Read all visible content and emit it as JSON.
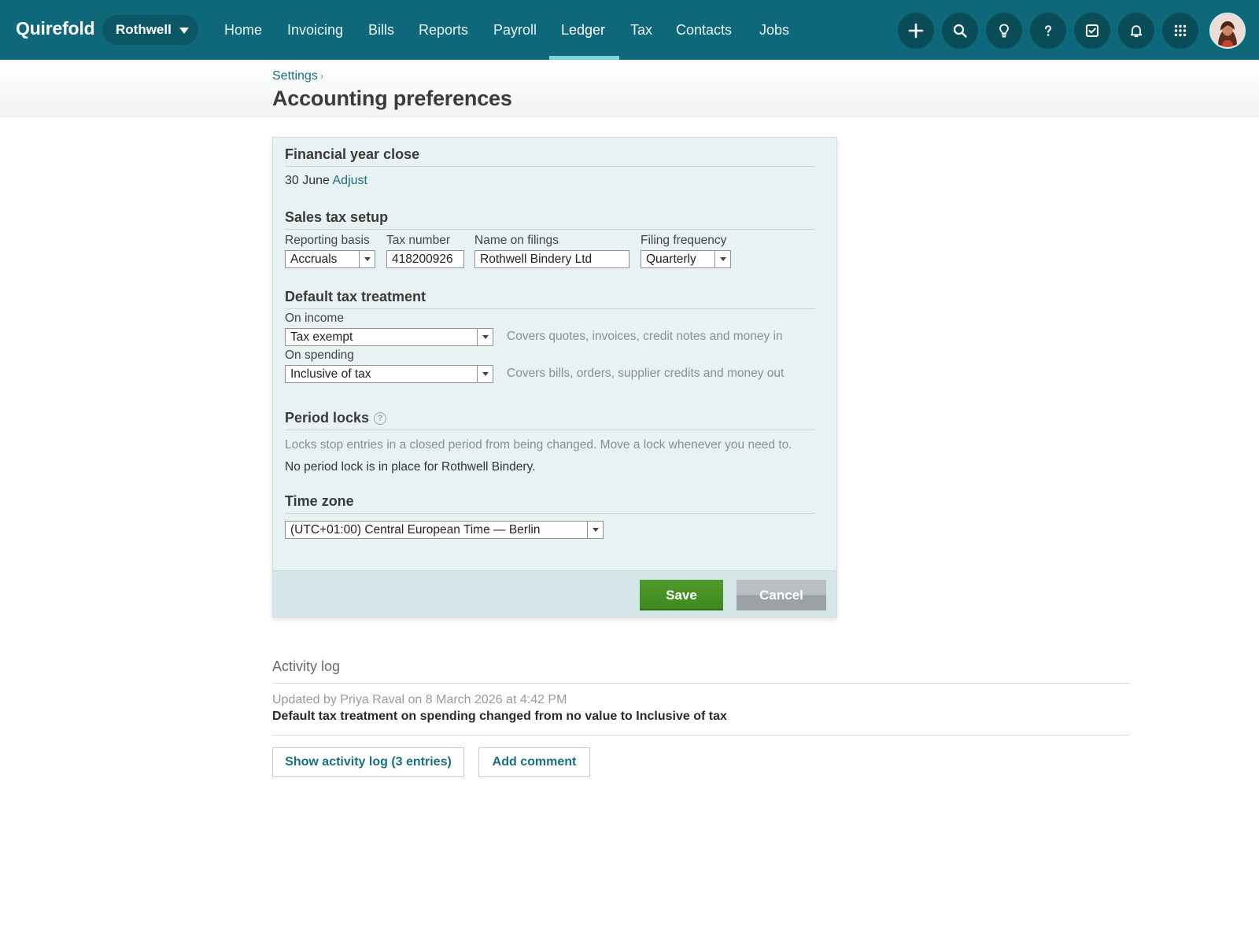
{
  "app": {
    "logo": "Quirefold",
    "org_switcher": "Rothwell"
  },
  "nav": {
    "items": [
      {
        "label": "Home"
      },
      {
        "label": "Invoicing"
      },
      {
        "label": "Bills"
      },
      {
        "label": "Reports"
      },
      {
        "label": "Payroll"
      },
      {
        "label": "Ledger",
        "active": true
      },
      {
        "label": "Tax"
      },
      {
        "label": "Contacts"
      },
      {
        "label": "Jobs"
      }
    ],
    "icons": [
      "plus-icon",
      "search-icon",
      "lightbulb-icon",
      "help-icon",
      "tasks-icon",
      "bell-icon",
      "apps-grid-icon"
    ]
  },
  "header": {
    "breadcrumb": "Settings",
    "breadcrumb_separator": "›",
    "title": "Accounting preferences"
  },
  "financial_year": {
    "title": "Financial year close",
    "value": "30 June",
    "adjust_label": "Adjust"
  },
  "sales_tax": {
    "title": "Sales tax setup",
    "reporting_basis_label": "Reporting basis",
    "reporting_basis_value": "Accruals",
    "tax_number_label": "Tax number",
    "tax_number_value": "418200926",
    "name_on_filings_label": "Name on filings",
    "name_on_filings_value": "Rothwell Bindery Ltd",
    "filing_frequency_label": "Filing frequency",
    "filing_frequency_value": "Quarterly"
  },
  "default_tax": {
    "title": "Default tax treatment",
    "income_label": "On income",
    "income_value": "Tax exempt",
    "income_hint": "Covers quotes, invoices, credit notes and money in",
    "spending_label": "On spending",
    "spending_value": "Inclusive of tax",
    "spending_hint": "Covers bills, orders, supplier credits and money out"
  },
  "period_locks": {
    "title": "Period locks",
    "help_glyph": "?",
    "description": "Locks stop entries in a closed period from being changed. Move a lock whenever you need to.",
    "status": "No period lock is in place for Rothwell Bindery."
  },
  "time_zone": {
    "title": "Time zone",
    "value": "(UTC+01:00) Central European Time — Berlin"
  },
  "actions": {
    "save": "Save",
    "cancel": "Cancel"
  },
  "activity": {
    "title": "Activity log",
    "meta": "Updated by Priya Raval on 8 March 2026 at 4:42 PM",
    "detail": "Default tax treatment on spending changed from no value to Inclusive of tax",
    "show_log_button": "Show activity log (3 entries)",
    "add_comment_button": "Add comment"
  },
  "colors": {
    "topbar": "#0f6879",
    "accent": "#1a6f7e",
    "save": "#3f8a1f",
    "panel": "#e8f2f2"
  }
}
